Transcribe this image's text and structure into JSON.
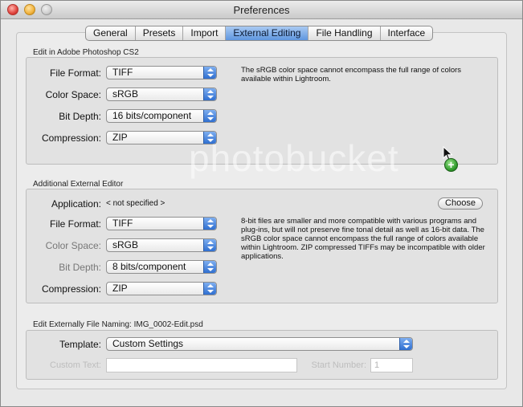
{
  "window": {
    "title": "Preferences"
  },
  "tabs": [
    {
      "label": "General",
      "active": false
    },
    {
      "label": "Presets",
      "active": false
    },
    {
      "label": "Import",
      "active": false
    },
    {
      "label": "External Editing",
      "active": true
    },
    {
      "label": "File Handling",
      "active": false
    },
    {
      "label": "Interface",
      "active": false
    }
  ],
  "photoshop": {
    "group_label": "Edit in Adobe Photoshop CS2",
    "file_format": {
      "label": "File Format:",
      "value": "TIFF"
    },
    "color_space": {
      "label": "Color Space:",
      "value": "sRGB"
    },
    "bit_depth": {
      "label": "Bit Depth:",
      "value": "16 bits/component"
    },
    "compression": {
      "label": "Compression:",
      "value": "ZIP"
    },
    "note": "The sRGB color space cannot encompass the full range of colors available within Lightroom."
  },
  "additional": {
    "group_label": "Additional External Editor",
    "application": {
      "label": "Application:",
      "value": "< not specified >"
    },
    "choose_label": "Choose",
    "file_format": {
      "label": "File Format:",
      "value": "TIFF"
    },
    "color_space": {
      "label": "Color Space:",
      "value": "sRGB"
    },
    "bit_depth": {
      "label": "Bit Depth:",
      "value": "8 bits/component"
    },
    "compression": {
      "label": "Compression:",
      "value": "ZIP"
    },
    "note": "8-bit files are smaller and more compatible with various programs and plug-ins, but will not preserve fine tonal detail as well as 16-bit data. The sRGB color space cannot encompass the full range of colors available within Lightroom. ZIP compressed TIFFs may be incompatible with older applications."
  },
  "naming": {
    "group_label": "Edit Externally File Naming:  IMG_0002-Edit.psd",
    "template": {
      "label": "Template:",
      "value": "Custom Settings"
    },
    "custom_text": {
      "label": "Custom Text:",
      "value": ""
    },
    "start_number": {
      "label": "Start Number:",
      "value": "1"
    }
  },
  "watermark_text": "photobucket",
  "colors": {
    "accent": "#5f96df",
    "badge": "#2e9a2a"
  },
  "icons": {
    "cursor": "arrow-cursor-icon",
    "add": "plus-badge-icon"
  }
}
